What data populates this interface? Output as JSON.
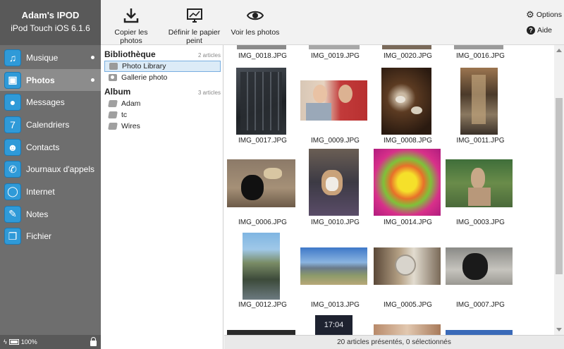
{
  "device": {
    "name": "Adam's IPOD",
    "model": "iPod Touch iOS 6.1.6"
  },
  "nav": [
    {
      "label": "Musique",
      "icon": "music-icon",
      "dot": true,
      "active": false
    },
    {
      "label": "Photos",
      "icon": "photos-icon",
      "dot": true,
      "active": true
    },
    {
      "label": "Messages",
      "icon": "messages-icon",
      "dot": false,
      "active": false
    },
    {
      "label": "Calendriers",
      "icon": "calendar-icon",
      "dot": false,
      "active": false
    },
    {
      "label": "Contacts",
      "icon": "contacts-icon",
      "dot": false,
      "active": false
    },
    {
      "label": "Journaux d'appels",
      "icon": "phone-icon",
      "dot": false,
      "active": false
    },
    {
      "label": "Internet",
      "icon": "internet-icon",
      "dot": false,
      "active": false
    },
    {
      "label": "Notes",
      "icon": "notes-icon",
      "dot": false,
      "active": false
    },
    {
      "label": "Fichier",
      "icon": "file-icon",
      "dot": false,
      "active": false
    }
  ],
  "footer": {
    "battery": "100%"
  },
  "toolbar": {
    "copy_label": "Copier les photos",
    "wallpaper_label": "Définir le papier peint",
    "view_label": "Voir les photos",
    "options_label": "Options",
    "help_label": "Aide"
  },
  "library": {
    "title": "Bibliothèque",
    "count": "2 articles",
    "items": [
      "Photo Library",
      "Gallerie photo"
    ],
    "selected": "Photo Library"
  },
  "album": {
    "title": "Album",
    "count": "3 articles",
    "items": [
      "Adam",
      "tc",
      "Wires"
    ]
  },
  "photos": [
    "IMG_0018.JPG",
    "IMG_0019.JPG",
    "IMG_0020.JPG",
    "IMG_0016.JPG",
    "IMG_0017.JPG",
    "IMG_0009.JPG",
    "IMG_0008.JPG",
    "IMG_0011.JPG",
    "IMG_0006.JPG",
    "IMG_0010.JPG",
    "IMG_0014.JPG",
    "IMG_0003.JPG",
    "IMG_0012.JPG",
    "IMG_0013.JPG",
    "IMG_0005.JPG",
    "IMG_0007.JPG"
  ],
  "partial_thumb_time": "17:04",
  "status": "20 articles présentés, 0 sélectionnés",
  "colors": {
    "accent": "#2f9ad8",
    "sidebar": "#6e6e6e",
    "selection": "#dcebf7"
  }
}
